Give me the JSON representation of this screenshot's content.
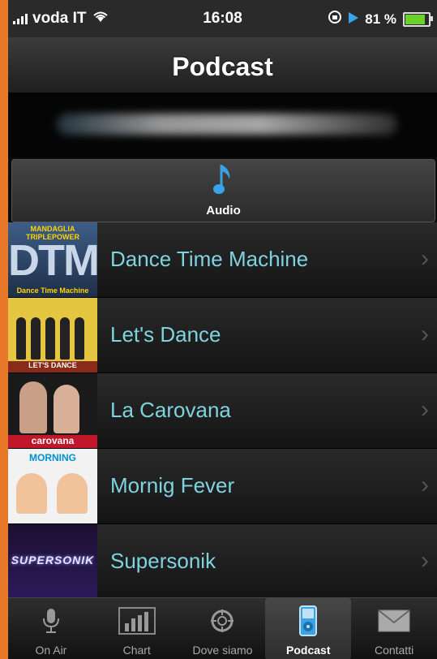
{
  "status_bar": {
    "carrier": "voda IT",
    "time": "16:08",
    "battery_percent": "81 %",
    "battery_level": 0.81
  },
  "navbar": {
    "title": "Podcast"
  },
  "segment": {
    "label": "Audio",
    "icon": "music-note-icon"
  },
  "podcasts": [
    {
      "label": "Dance Time Machine",
      "thumb_title": "DTM",
      "thumb_caption": "MANDAGLIA TRIPLEPOWER",
      "thumb_sub": "Dance Time Machine"
    },
    {
      "label": "Let's Dance",
      "thumb_caption": "LET'S DANCE"
    },
    {
      "label": "La Carovana",
      "thumb_caption": "carovana"
    },
    {
      "label": "Mornig Fever",
      "thumb_caption": "MORNING"
    },
    {
      "label": "Supersonik",
      "thumb_caption": "SUPERSONIK"
    }
  ],
  "tabbar": {
    "tabs": [
      {
        "label": "On Air",
        "icon": "microphone-icon",
        "active": false
      },
      {
        "label": "Chart",
        "icon": "bar-chart-icon",
        "active": false
      },
      {
        "label": "Dove siamo",
        "icon": "crosshair-icon",
        "active": false
      },
      {
        "label": "Podcast",
        "icon": "ipod-icon",
        "active": true
      },
      {
        "label": "Contatti",
        "icon": "envelope-icon",
        "active": false
      }
    ]
  },
  "colors": {
    "accent_label": "#7fd3de",
    "note_blue": "#3aa3e8",
    "outer_frame": "#e8782a"
  }
}
